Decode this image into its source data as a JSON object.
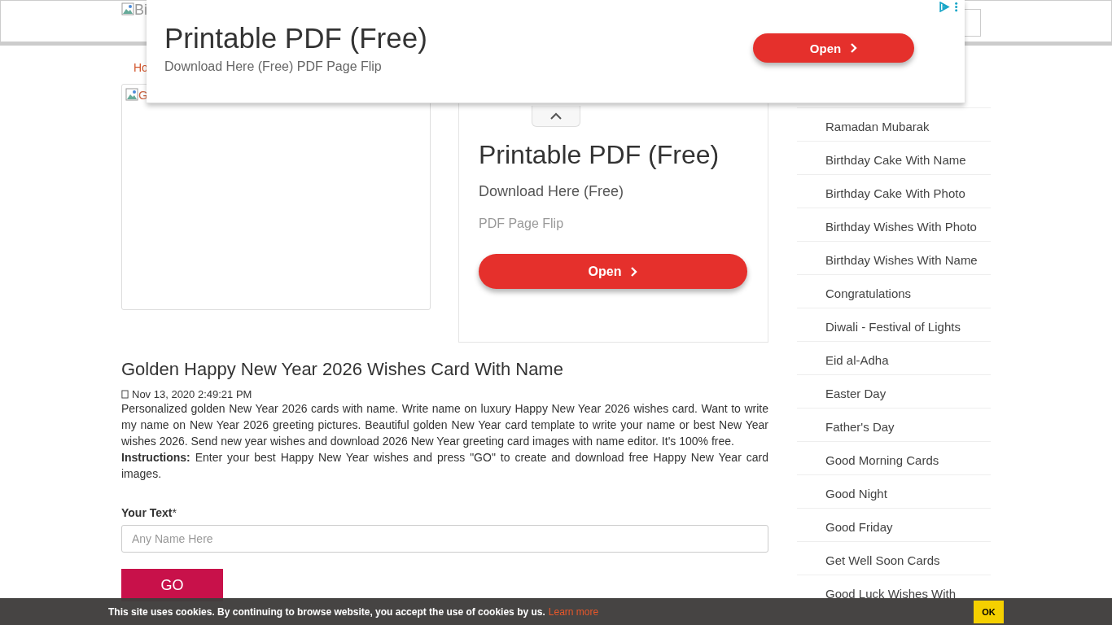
{
  "header": {
    "logo_alt": "Bi"
  },
  "breadcrumb": "Ho",
  "card_image": {
    "alt": "G"
  },
  "ad_overlay": {
    "title": "Printable PDF (Free)",
    "subtitle": "Download Here (Free) PDF Page Flip",
    "button": "Open"
  },
  "ad_box": {
    "title": "Printable PDF (Free)",
    "line_1": "Download Here (Free)",
    "line_2": "PDF Page Flip",
    "button": "Open"
  },
  "article": {
    "title": "Golden Happy New Year 2026 Wishes Card With Name",
    "date": "Nov 13, 2020 2:49:21 PM",
    "description": "Personalized golden New Year 2026 cards with name. Write name on luxury Happy New Year 2026 wishes card. Want to write my name on New Year 2026 greeting pictures. Beautiful golden New Year card template to write your name or best New Year wishes 2026. Send new year wishes and download 2026 New Year greeting card images with name editor. It's 100% free.",
    "instructions": "**Instructions:** Enter your best Happy New Year wishes and press \"GO\" to create and download free Happy New Year card images."
  },
  "form": {
    "label": "Your Text",
    "required_mark": "*",
    "placeholder": "Any Name Here",
    "button": "GO"
  },
  "sidebar": {
    "items": [
      "Ramadan Mubarak",
      "Birthday Cake With Name",
      "Birthday Cake With Photo",
      "Birthday Wishes With Photo",
      "Birthday Wishes With Name",
      "Congratulations",
      "Diwali - Festival of Lights",
      "Eid al-Adha",
      "Easter Day",
      "Father's Day",
      "Good Morning Cards",
      "Good Night",
      "Good Friday",
      "Get Well Soon Cards",
      "Good Luck Wishes With"
    ]
  },
  "cookie_bar": {
    "text": "This site uses cookies. By continuing to browse website, you accept the use of cookies by us.",
    "link": "Learn more",
    "button": "OK"
  }
}
